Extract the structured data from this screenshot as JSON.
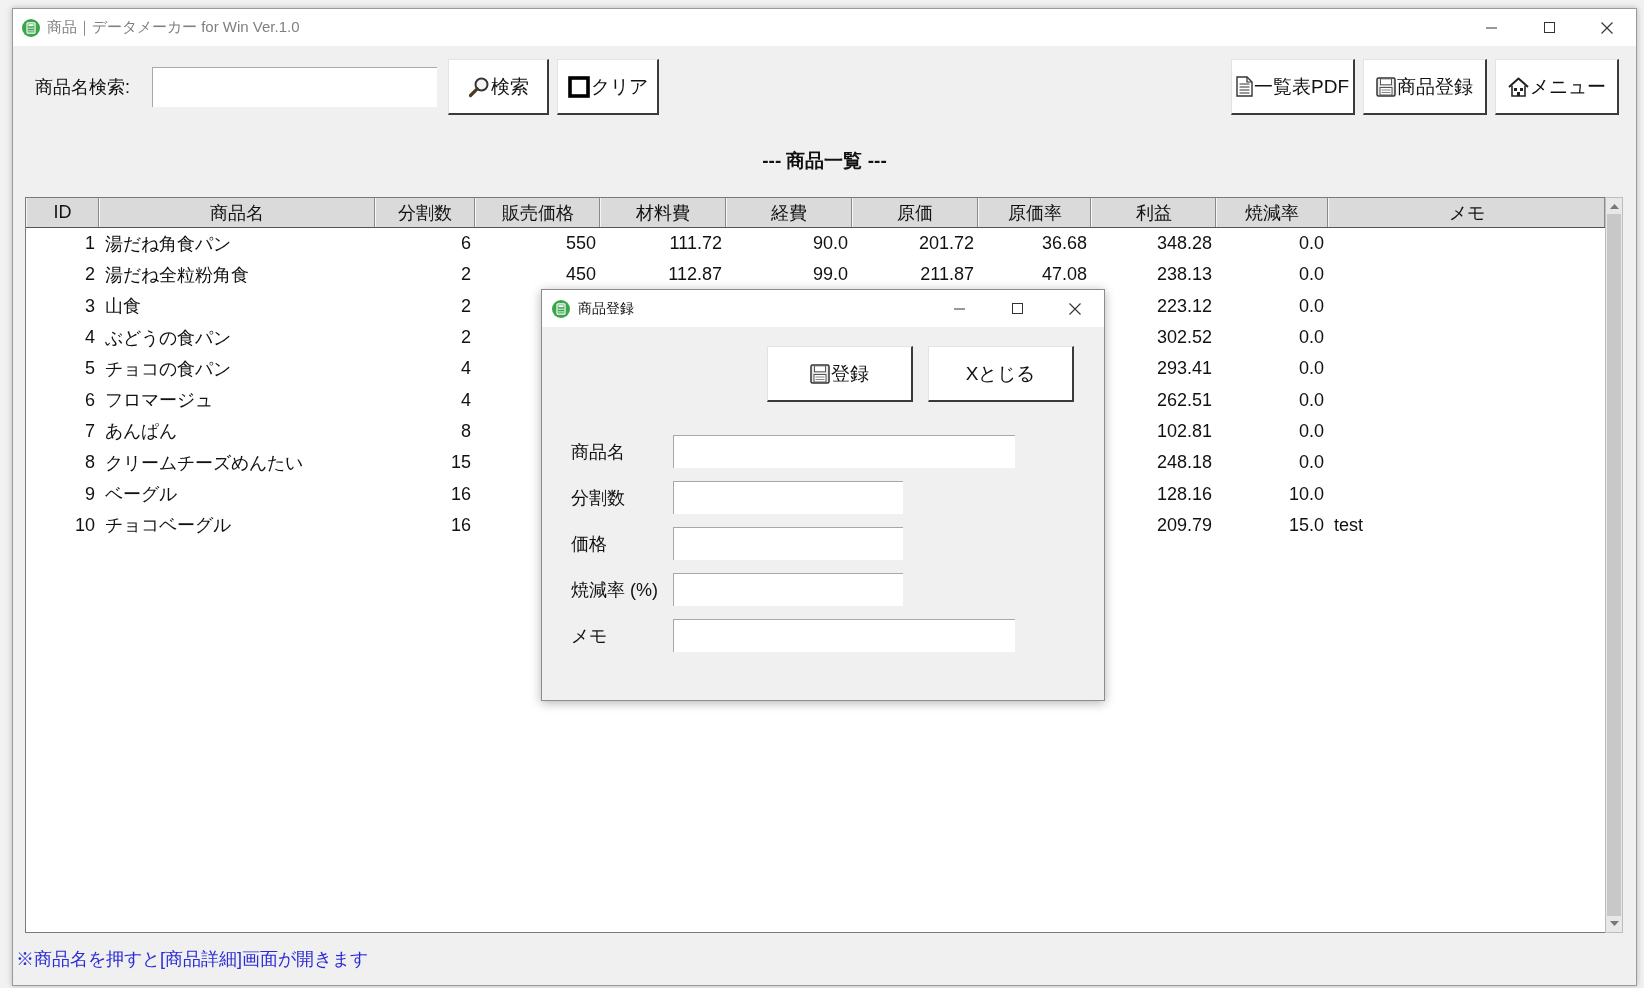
{
  "window": {
    "title": "商品｜データメーカー for Win Ver.1.0"
  },
  "toolbar": {
    "search_label": "商品名検索:",
    "left_buttons": [
      {
        "kind": "search",
        "label": "検索"
      },
      {
        "kind": "clear",
        "label": "クリア"
      }
    ],
    "right_buttons": [
      {
        "kind": "pdf",
        "label": "一覧表PDF"
      },
      {
        "kind": "save",
        "label": "商品登録"
      },
      {
        "kind": "home",
        "label": "メニュー"
      }
    ]
  },
  "list_title": "--- 商品一覧 ---",
  "table": {
    "columns": [
      "ID",
      "商品名",
      "分割数",
      "販売価格",
      "材料費",
      "経費",
      "原価",
      "原価率",
      "利益",
      "焼減率",
      "メモ"
    ],
    "rows": [
      {
        "id": "1",
        "name": "湯だね角食パン",
        "split": "6",
        "price": "550",
        "material": "111.72",
        "expense": "90.0",
        "cost": "201.72",
        "cost_rate": "36.68",
        "profit": "348.28",
        "loss_rate": "0.0"
      },
      {
        "id": "2",
        "name": "湯だね全粒粉角食",
        "split": "2",
        "price": "450",
        "material": "112.87",
        "expense": "99.0",
        "cost": "211.87",
        "cost_rate": "47.08",
        "profit": "238.13",
        "loss_rate": "0.0"
      },
      {
        "id": "3",
        "name": "山食",
        "split": "2",
        "profit": "223.12",
        "loss_rate": "0.0"
      },
      {
        "id": "4",
        "name": "ぶどうの食パン",
        "split": "2",
        "profit": "302.52",
        "loss_rate": "0.0"
      },
      {
        "id": "5",
        "name": "チョコの食パン",
        "split": "4",
        "profit": "293.41",
        "loss_rate": "0.0"
      },
      {
        "id": "6",
        "name": "フロマージュ",
        "split": "4",
        "profit": "262.51",
        "loss_rate": "0.0"
      },
      {
        "id": "7",
        "name": "あんぱん",
        "split": "8",
        "profit": "102.81",
        "loss_rate": "0.0"
      },
      {
        "id": "8",
        "name": "クリームチーズめんたい",
        "split": "15",
        "profit": "248.18",
        "loss_rate": "0.0"
      },
      {
        "id": "9",
        "name": "ベーグル",
        "split": "16",
        "profit": "128.16",
        "loss_rate": "10.0"
      },
      {
        "id": "10",
        "name": "チョコベーグル",
        "split": "16",
        "profit": "209.79",
        "loss_rate": "15.0",
        "memo": "test"
      }
    ]
  },
  "status_bar": {
    "hint": "※商品名を押すと[商品詳細]画面が開きます"
  },
  "dialog": {
    "title": "商品登録",
    "buttons": [
      {
        "kind": "save",
        "label": "登録"
      },
      {
        "kind": "close",
        "label": "Xとじる"
      }
    ],
    "fields": [
      {
        "label": "商品名",
        "kind": "wide"
      },
      {
        "label": "分割数",
        "kind": "narrow"
      },
      {
        "label": "価格",
        "kind": "narrow"
      },
      {
        "label": "焼減率 (%)",
        "kind": "narrow"
      },
      {
        "label": "メモ",
        "kind": "wide"
      }
    ]
  }
}
